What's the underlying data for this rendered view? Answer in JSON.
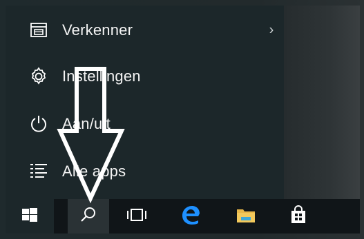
{
  "start_menu": {
    "items": [
      {
        "label": "Verkenner",
        "icon": "file-explorer-icon",
        "has_submenu": true
      },
      {
        "label": "Instellingen",
        "icon": "gear-icon"
      },
      {
        "label": "Aan/uit",
        "icon": "power-icon"
      },
      {
        "label": "Alle apps",
        "icon": "all-apps-icon"
      }
    ]
  },
  "taskbar": {
    "buttons": [
      {
        "name": "start",
        "icon": "windows-logo-icon"
      },
      {
        "name": "search",
        "icon": "search-icon"
      },
      {
        "name": "task-view",
        "icon": "task-view-icon"
      },
      {
        "name": "edge",
        "icon": "edge-icon"
      },
      {
        "name": "file-explorer",
        "icon": "folder-icon"
      },
      {
        "name": "store",
        "icon": "store-icon"
      }
    ]
  },
  "annotation": {
    "type": "arrow",
    "direction": "down",
    "color": "#ffffff"
  },
  "colors": {
    "menu_bg": "#1c272a",
    "taskbar_bg": "#101518",
    "accent": "#1e90ff"
  }
}
